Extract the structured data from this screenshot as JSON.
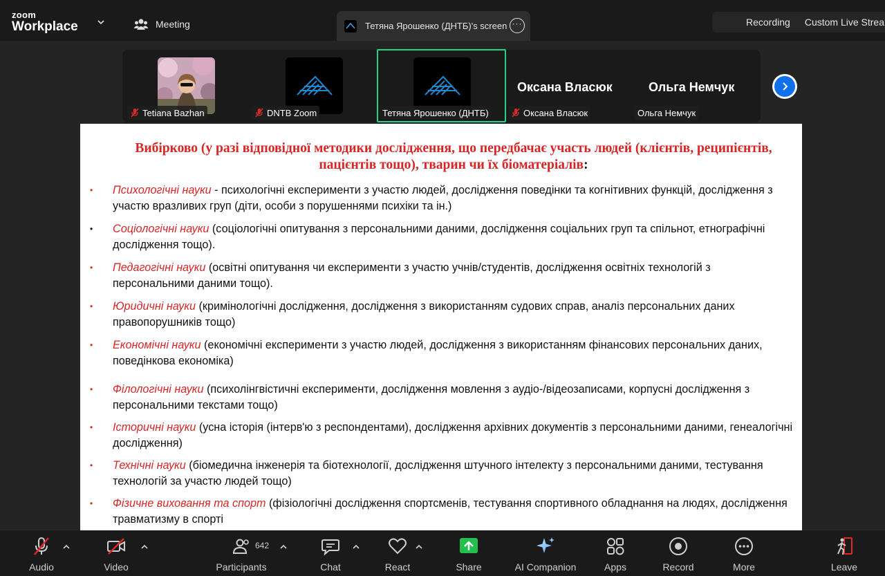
{
  "app": {
    "logo_top": "zoom",
    "logo_bottom": "Workplace"
  },
  "topbar": {
    "meeting_tab": "Meeting",
    "share_tab": "Тетяна Ярошенко (ДНТБ)'s screen",
    "recording_label": "Recording",
    "live_label": "Custom Live Stream"
  },
  "participants_strip": [
    {
      "name": "Tetiana Bazhan",
      "muted": true
    },
    {
      "name": "DNTB Zoom",
      "muted": true
    },
    {
      "name": "Тетяна Ярошенко (ДНТБ)",
      "muted": false,
      "active": true
    },
    {
      "name": "Оксана Власюк",
      "muted": true,
      "big_name": "Оксана Власюк"
    },
    {
      "name": "Ольга Немчук",
      "muted": false,
      "big_name": "Ольга Немчук"
    }
  ],
  "slide": {
    "title": "Вибірково (у разі відповідної методики дослідження, що передбачає участь людей (клієнтів, реципієнтів, пацієнтів тощо), тварин чи їх біоматеріалів",
    "title_colon": ":",
    "items": [
      {
        "field": "Психологічні науки",
        "text": " - психологічні експерименти з участю людей, дослідження поведінки та когнітивних функцій, дослідження з участю вразливих груп (діти, особи з порушеннями психіки та ін.)"
      },
      {
        "field": " Соціологічні науки",
        "text": " (соціологічні опитування з персональними даними, дослідження соціальних груп та спільнот, етнографічні дослідження тощо)."
      },
      {
        "field": "Педагогічні науки",
        "text": " (освітні опитування чи експерименти з участю учнів/студентів, дослідження освітніх технологій з персональними даними тощо)."
      },
      {
        "field": "Юридичні науки",
        "text": " (кримінологічні дослідження, дослідження з використанням судових справ, аналіз персональних даних правопорушників тощо)"
      },
      {
        "field": "Економічні науки",
        "text": " (економічні експерименти з участю людей, дослідження з використанням фінансових персональних даних, поведінкова економіка)"
      },
      {
        "field": "Філологічні науки",
        "text": " (психолінгвістичні експерименти, дослідження мовлення з аудіо-/відеозаписами, корпусні дослідження з персональними текстами тощо)"
      },
      {
        "field": "Історичні науки",
        "text": " (усна історія (інтерв'ю з респондентами), дослідження архівних документів з персональними даними, генеалогічні дослідження)"
      },
      {
        "field": "Технічні науки",
        "text": " (біомедична інженерія та біотехнології, дослідження штучного інтелекту з персональними даними, тестування технологій за участю людей тощо)"
      },
      {
        "field": "Фізичне виховання та спорт",
        "text": " (фізіологічні дослідження спортсменів, тестування спортивного обладнання на людях, дослідження травматизму в спорті"
      }
    ]
  },
  "toolbar": {
    "audio": "Audio",
    "video": "Video",
    "participants": "Participants",
    "participants_count": "642",
    "chat": "Chat",
    "react": "React",
    "share": "Share",
    "ai_companion": "AI Companion",
    "apps": "Apps",
    "record": "Record",
    "more": "More",
    "leave": "Leave"
  },
  "colors": {
    "accent_red": "#d62626",
    "share_green": "#23d18b",
    "zoom_blue": "#0e71eb"
  }
}
